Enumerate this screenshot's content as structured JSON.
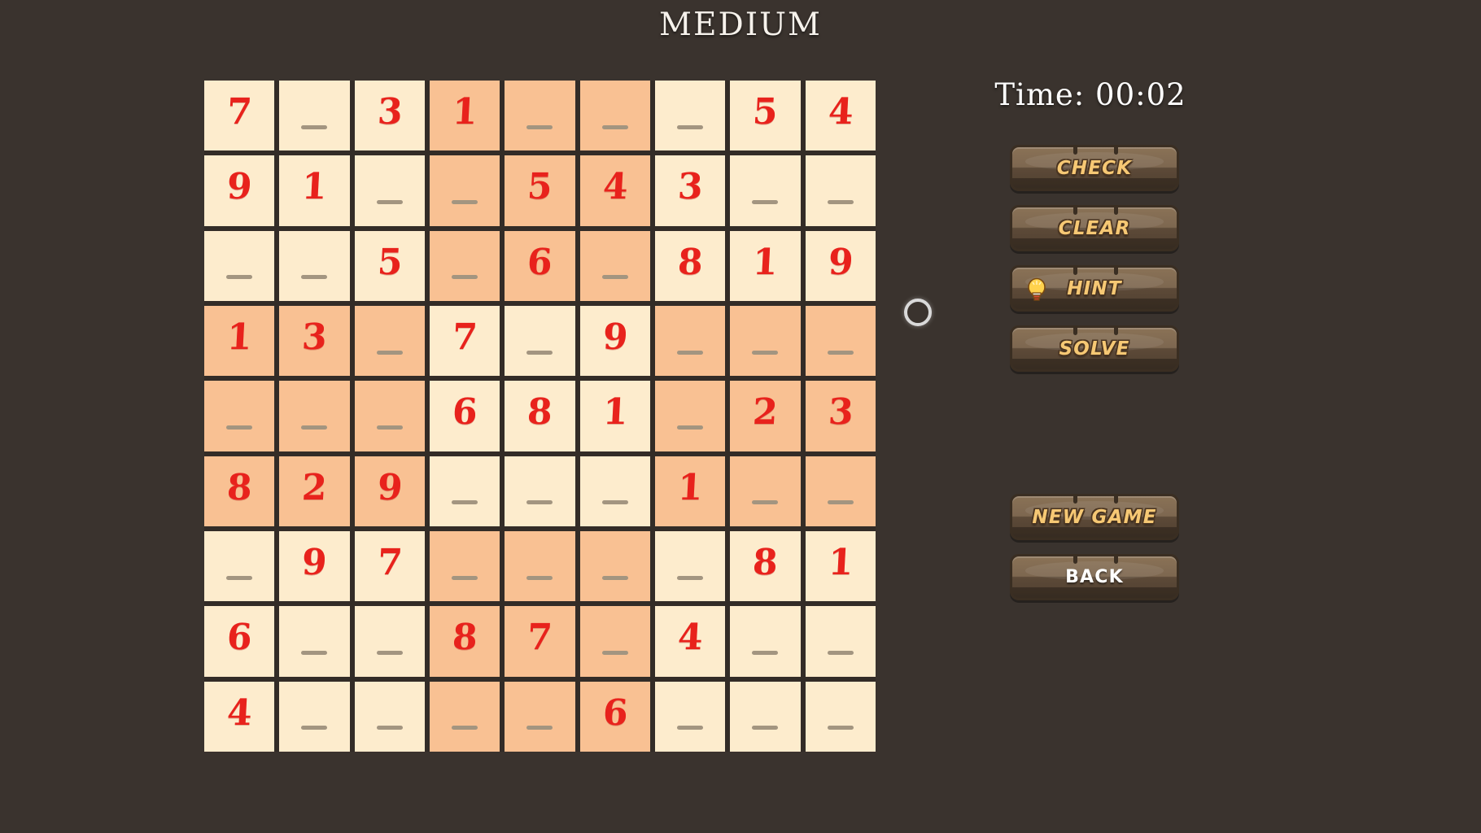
{
  "header": {
    "title": "MEDIUM"
  },
  "timer": {
    "label": "Time:",
    "value": "00:02",
    "display": "Time: 00:02"
  },
  "buttons": {
    "check": "CHECK",
    "clear": "CLEAR",
    "hint": "HINT",
    "solve": "SOLVE",
    "new_game": "NEW GAME",
    "back": "BACK"
  },
  "colors": {
    "background": "#3a332e",
    "cell_light": "#fdeccd",
    "cell_shaded": "#f9c193",
    "digit_red": "#e8221c",
    "button_label_gold": "#f6c874",
    "grid_line": "#332c27",
    "empty_dash": "#a39580",
    "title_white": "#f6f2ec"
  },
  "icons": {
    "hint": "lightbulb-icon",
    "cursor": "cursor-ring-icon"
  },
  "board": {
    "size": 9,
    "empty_token": "_",
    "rows": [
      [
        "7",
        "_",
        "3",
        "1",
        "_",
        "_",
        "_",
        "5",
        "4"
      ],
      [
        "9",
        "1",
        "_",
        "_",
        "5",
        "4",
        "3",
        "_",
        "_"
      ],
      [
        "_",
        "_",
        "5",
        "_",
        "6",
        "_",
        "8",
        "1",
        "9"
      ],
      [
        "1",
        "3",
        "_",
        "7",
        "_",
        "9",
        "_",
        "_",
        "_"
      ],
      [
        "_",
        "_",
        "_",
        "6",
        "8",
        "1",
        "_",
        "2",
        "3"
      ],
      [
        "8",
        "2",
        "9",
        "_",
        "_",
        "_",
        "1",
        "_",
        "_"
      ],
      [
        "_",
        "9",
        "7",
        "_",
        "_",
        "_",
        "_",
        "8",
        "1"
      ],
      [
        "6",
        "_",
        "_",
        "8",
        "7",
        "_",
        "4",
        "_",
        "_"
      ],
      [
        "4",
        "_",
        "_",
        "_",
        "_",
        "6",
        "_",
        "_",
        "_"
      ]
    ],
    "shaded_boxes": [
      1,
      3,
      5,
      7
    ]
  }
}
